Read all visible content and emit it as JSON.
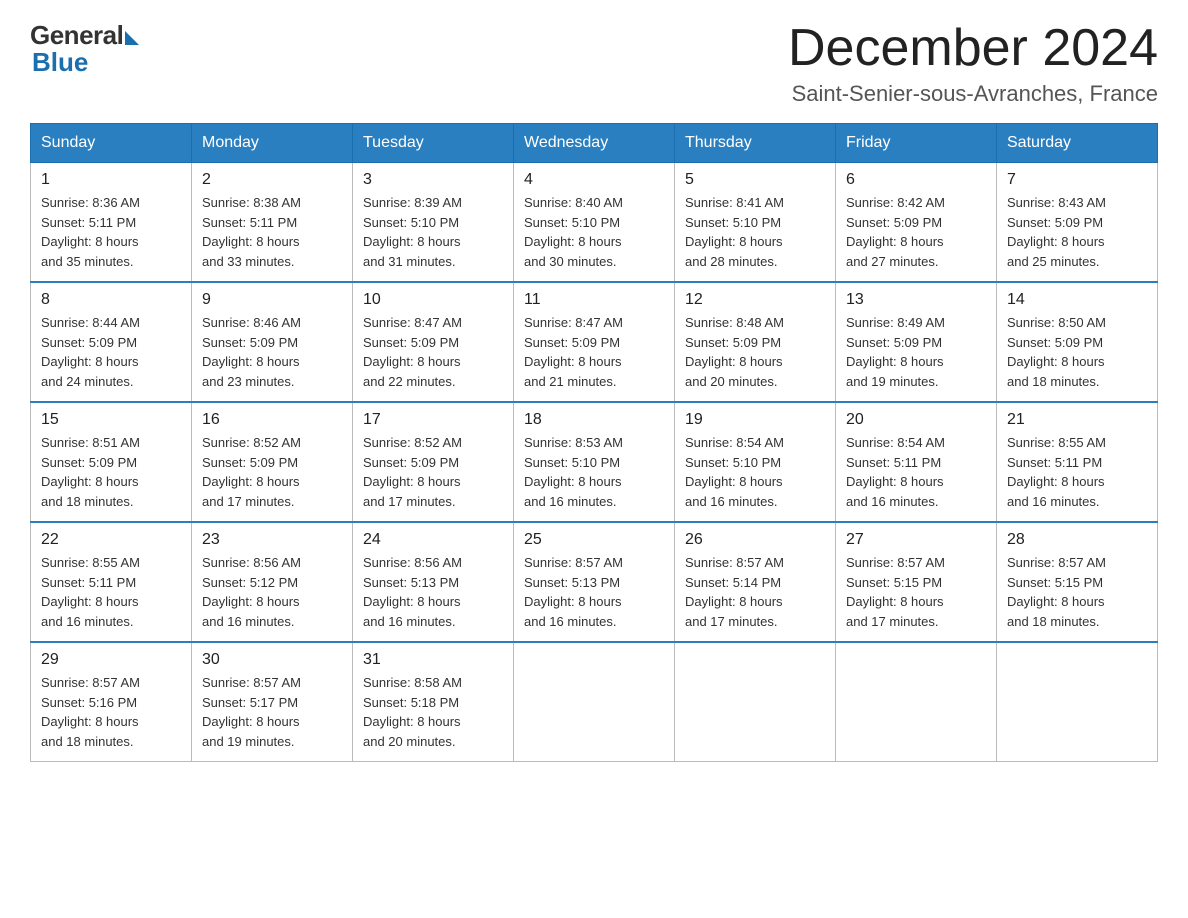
{
  "header": {
    "logo_general": "General",
    "logo_blue": "Blue",
    "month_title": "December 2024",
    "location": "Saint-Senier-sous-Avranches, France"
  },
  "weekdays": [
    "Sunday",
    "Monday",
    "Tuesday",
    "Wednesday",
    "Thursday",
    "Friday",
    "Saturday"
  ],
  "days": [
    {
      "date": "1",
      "sunrise": "8:36 AM",
      "sunset": "5:11 PM",
      "daylight": "8 hours and 35 minutes."
    },
    {
      "date": "2",
      "sunrise": "8:38 AM",
      "sunset": "5:11 PM",
      "daylight": "8 hours and 33 minutes."
    },
    {
      "date": "3",
      "sunrise": "8:39 AM",
      "sunset": "5:10 PM",
      "daylight": "8 hours and 31 minutes."
    },
    {
      "date": "4",
      "sunrise": "8:40 AM",
      "sunset": "5:10 PM",
      "daylight": "8 hours and 30 minutes."
    },
    {
      "date": "5",
      "sunrise": "8:41 AM",
      "sunset": "5:10 PM",
      "daylight": "8 hours and 28 minutes."
    },
    {
      "date": "6",
      "sunrise": "8:42 AM",
      "sunset": "5:09 PM",
      "daylight": "8 hours and 27 minutes."
    },
    {
      "date": "7",
      "sunrise": "8:43 AM",
      "sunset": "5:09 PM",
      "daylight": "8 hours and 25 minutes."
    },
    {
      "date": "8",
      "sunrise": "8:44 AM",
      "sunset": "5:09 PM",
      "daylight": "8 hours and 24 minutes."
    },
    {
      "date": "9",
      "sunrise": "8:46 AM",
      "sunset": "5:09 PM",
      "daylight": "8 hours and 23 minutes."
    },
    {
      "date": "10",
      "sunrise": "8:47 AM",
      "sunset": "5:09 PM",
      "daylight": "8 hours and 22 minutes."
    },
    {
      "date": "11",
      "sunrise": "8:47 AM",
      "sunset": "5:09 PM",
      "daylight": "8 hours and 21 minutes."
    },
    {
      "date": "12",
      "sunrise": "8:48 AM",
      "sunset": "5:09 PM",
      "daylight": "8 hours and 20 minutes."
    },
    {
      "date": "13",
      "sunrise": "8:49 AM",
      "sunset": "5:09 PM",
      "daylight": "8 hours and 19 minutes."
    },
    {
      "date": "14",
      "sunrise": "8:50 AM",
      "sunset": "5:09 PM",
      "daylight": "8 hours and 18 minutes."
    },
    {
      "date": "15",
      "sunrise": "8:51 AM",
      "sunset": "5:09 PM",
      "daylight": "8 hours and 18 minutes."
    },
    {
      "date": "16",
      "sunrise": "8:52 AM",
      "sunset": "5:09 PM",
      "daylight": "8 hours and 17 minutes."
    },
    {
      "date": "17",
      "sunrise": "8:52 AM",
      "sunset": "5:09 PM",
      "daylight": "8 hours and 17 minutes."
    },
    {
      "date": "18",
      "sunrise": "8:53 AM",
      "sunset": "5:10 PM",
      "daylight": "8 hours and 16 minutes."
    },
    {
      "date": "19",
      "sunrise": "8:54 AM",
      "sunset": "5:10 PM",
      "daylight": "8 hours and 16 minutes."
    },
    {
      "date": "20",
      "sunrise": "8:54 AM",
      "sunset": "5:11 PM",
      "daylight": "8 hours and 16 minutes."
    },
    {
      "date": "21",
      "sunrise": "8:55 AM",
      "sunset": "5:11 PM",
      "daylight": "8 hours and 16 minutes."
    },
    {
      "date": "22",
      "sunrise": "8:55 AM",
      "sunset": "5:11 PM",
      "daylight": "8 hours and 16 minutes."
    },
    {
      "date": "23",
      "sunrise": "8:56 AM",
      "sunset": "5:12 PM",
      "daylight": "8 hours and 16 minutes."
    },
    {
      "date": "24",
      "sunrise": "8:56 AM",
      "sunset": "5:13 PM",
      "daylight": "8 hours and 16 minutes."
    },
    {
      "date": "25",
      "sunrise": "8:57 AM",
      "sunset": "5:13 PM",
      "daylight": "8 hours and 16 minutes."
    },
    {
      "date": "26",
      "sunrise": "8:57 AM",
      "sunset": "5:14 PM",
      "daylight": "8 hours and 17 minutes."
    },
    {
      "date": "27",
      "sunrise": "8:57 AM",
      "sunset": "5:15 PM",
      "daylight": "8 hours and 17 minutes."
    },
    {
      "date": "28",
      "sunrise": "8:57 AM",
      "sunset": "5:15 PM",
      "daylight": "8 hours and 18 minutes."
    },
    {
      "date": "29",
      "sunrise": "8:57 AM",
      "sunset": "5:16 PM",
      "daylight": "8 hours and 18 minutes."
    },
    {
      "date": "30",
      "sunrise": "8:57 AM",
      "sunset": "5:17 PM",
      "daylight": "8 hours and 19 minutes."
    },
    {
      "date": "31",
      "sunrise": "8:58 AM",
      "sunset": "5:18 PM",
      "daylight": "8 hours and 20 minutes."
    }
  ],
  "labels": {
    "sunrise": "Sunrise:",
    "sunset": "Sunset:",
    "daylight": "Daylight:"
  }
}
